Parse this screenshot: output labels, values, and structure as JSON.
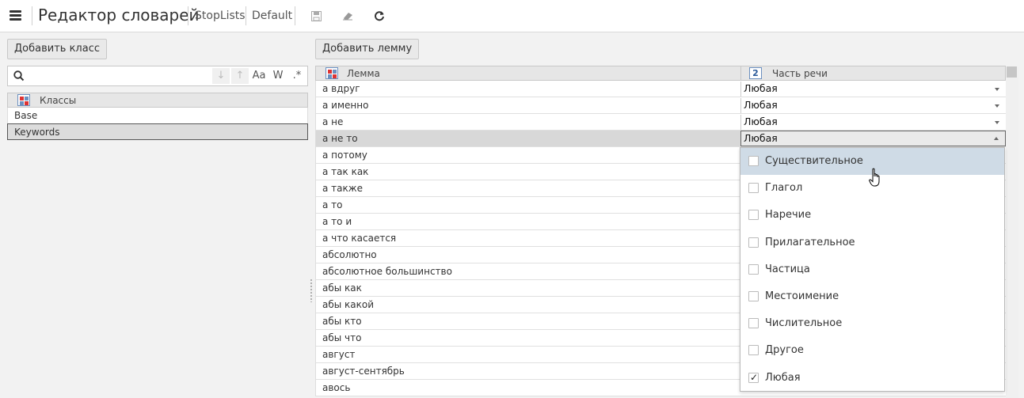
{
  "header": {
    "title": "Редактор словарей",
    "crumbs": [
      "StopLists",
      "Default"
    ]
  },
  "left": {
    "add_class_label": "Добавить класс",
    "search": {
      "value": "",
      "placeholder": ""
    },
    "search_buttons": [
      "↓",
      "↑",
      "Aa",
      "W",
      ".*"
    ],
    "grid_header": "Классы",
    "classes": [
      "Base",
      "Keywords"
    ],
    "selected_class": "Keywords"
  },
  "main": {
    "add_lemma_label": "Добавить лемму",
    "col_lemma": "Лемма",
    "col_pos": "Часть речи",
    "pos_header_icon_text": "2",
    "rows": [
      {
        "lemma": "а вдруг",
        "pos": "Любая"
      },
      {
        "lemma": "а именно",
        "pos": "Любая"
      },
      {
        "lemma": "а не",
        "pos": "Любая"
      },
      {
        "lemma": "а не то",
        "pos": "Любая"
      },
      {
        "lemma": "а потому",
        "pos": ""
      },
      {
        "lemma": "а так как",
        "pos": ""
      },
      {
        "lemma": "а также",
        "pos": ""
      },
      {
        "lemma": "а то",
        "pos": ""
      },
      {
        "lemma": "а то и",
        "pos": ""
      },
      {
        "lemma": "а что касается",
        "pos": ""
      },
      {
        "lemma": "абсолютно",
        "pos": ""
      },
      {
        "lemma": "абсолютное большинство",
        "pos": ""
      },
      {
        "lemma": "абы как",
        "pos": ""
      },
      {
        "lemma": "абы какой",
        "pos": ""
      },
      {
        "lemma": "абы кто",
        "pos": ""
      },
      {
        "lemma": "абы что",
        "pos": ""
      },
      {
        "lemma": "август",
        "pos": ""
      },
      {
        "lemma": "август-сентябрь",
        "pos": ""
      },
      {
        "lemma": "авось",
        "pos": ""
      }
    ],
    "selected_row": "а не то"
  },
  "dropdown": {
    "options": [
      {
        "label": "Существительное",
        "checked": false
      },
      {
        "label": "Глагол",
        "checked": false
      },
      {
        "label": "Наречие",
        "checked": false
      },
      {
        "label": "Прилагательное",
        "checked": false
      },
      {
        "label": "Частица",
        "checked": false
      },
      {
        "label": "Местоимение",
        "checked": false
      },
      {
        "label": "Числительное",
        "checked": false
      },
      {
        "label": "Другое",
        "checked": false
      },
      {
        "label": "Любая",
        "checked": true
      }
    ],
    "hovered": "Существительное"
  }
}
